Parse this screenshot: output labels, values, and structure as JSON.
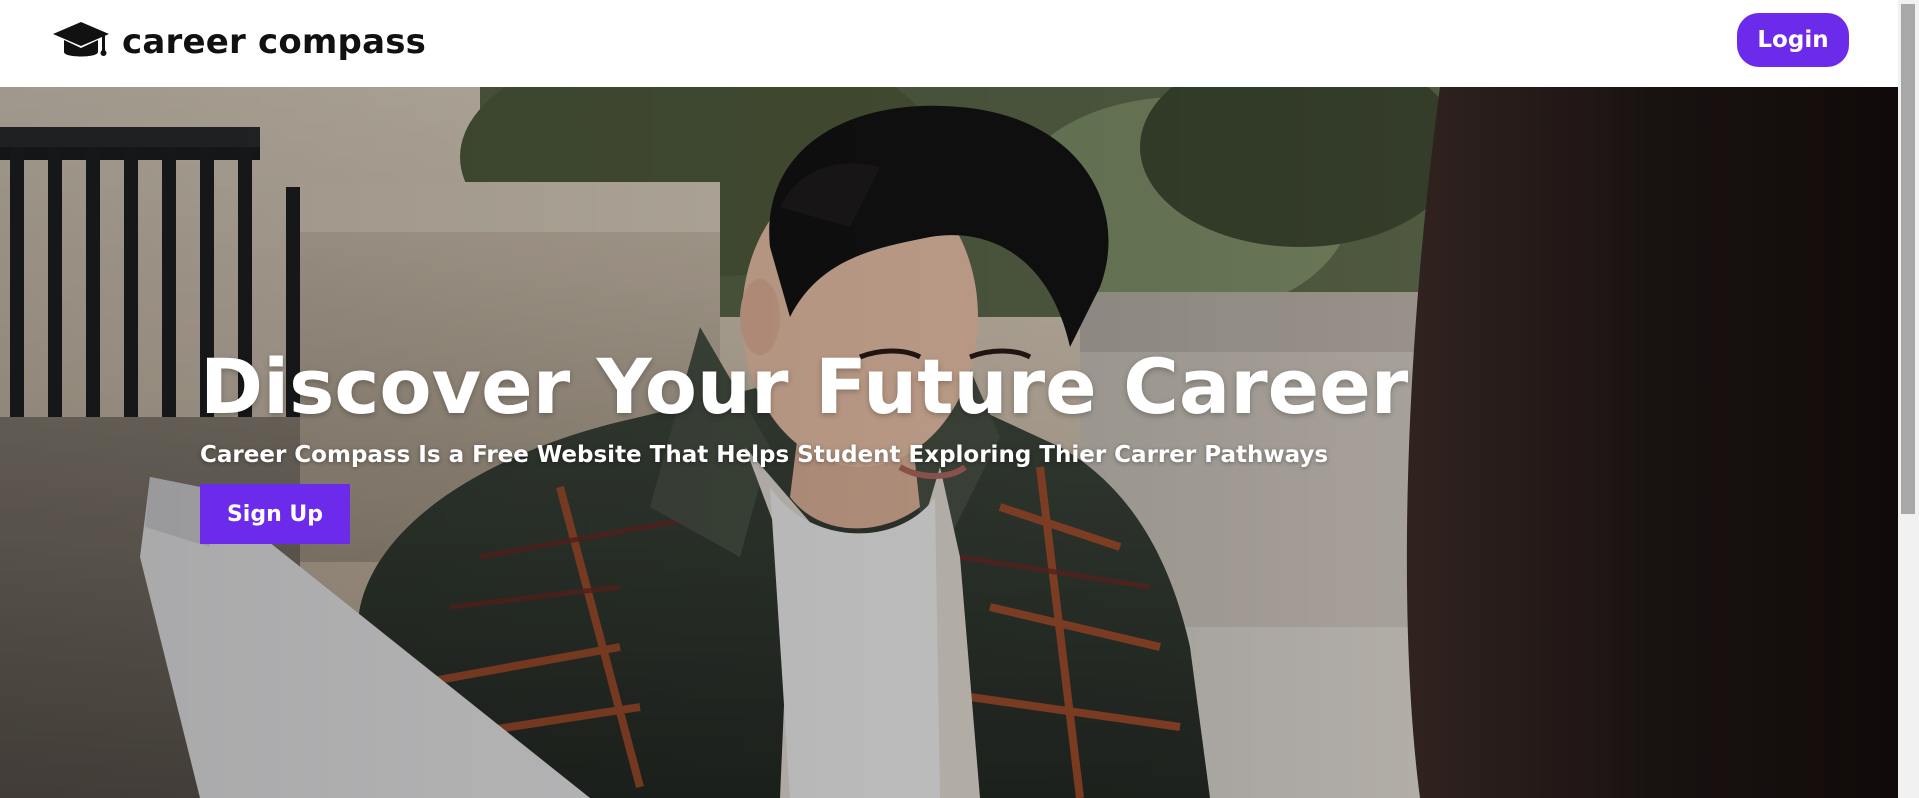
{
  "header": {
    "brand_icon": "graduation-cap-icon",
    "brand_name": "career compass",
    "login_label": "Login"
  },
  "hero": {
    "title": "Discover Your Future Career",
    "subtitle": "Career Compass Is a Free Website That Helps Student Exploring Thier Carrer Pathways",
    "signup_label": "Sign Up"
  },
  "colors": {
    "accent": "#6c2bea",
    "header_bg": "#ffffff",
    "hero_text": "#ffffff"
  }
}
